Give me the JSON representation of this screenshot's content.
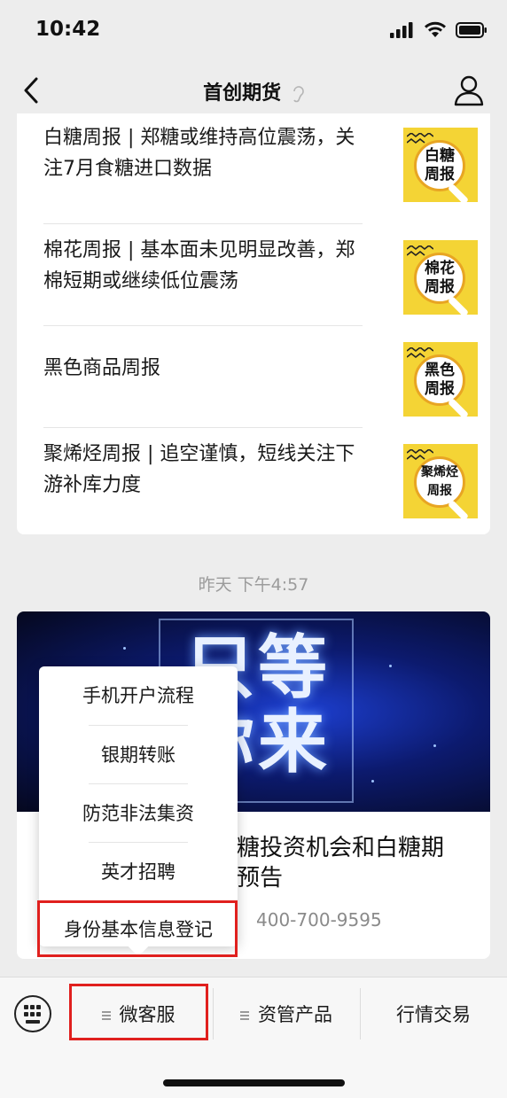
{
  "status_bar": {
    "time": "10:42"
  },
  "nav": {
    "title": "首创期货"
  },
  "articles": [
    {
      "title": "白糖周报 | 郑糖或维持高位震荡，关注7月食糖进口数据",
      "thumb": "白糖\n周报"
    },
    {
      "title": "棉花周报 | 基本面未见明显改善，郑棉短期或继续低位震荡",
      "thumb": "棉花\n周报"
    },
    {
      "title": "黑色商品周报",
      "thumb": "黑色\n周报"
    },
    {
      "title": "聚烯烃周报 | 追空谨慎，短线关注下游补库力度",
      "thumb": "聚烯烃\n周报"
    }
  ],
  "timestamp": "昨天 下午4:57",
  "card2": {
    "banner_text": "只等\n你来",
    "heading": "糖投资机会和白糖期\n预告",
    "phone": "400-700-9595"
  },
  "popup_menu": {
    "items": [
      "手机开户流程",
      "银期转账",
      "防范非法集资",
      "英才招聘",
      "身份基本信息登记"
    ]
  },
  "bottom_menu": {
    "items": [
      "微客服",
      "资管产品",
      "行情交易"
    ]
  },
  "colors": {
    "highlight": "#e0201e",
    "thumb_bg": "#f4d435"
  }
}
